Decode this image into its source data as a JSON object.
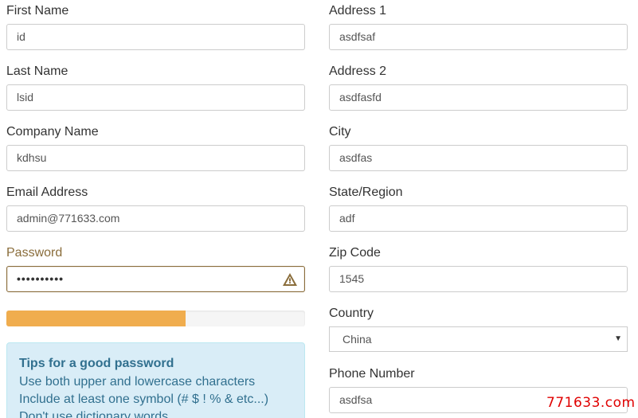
{
  "left": {
    "first_name": {
      "label": "First Name",
      "value": "id"
    },
    "last_name": {
      "label": "Last Name",
      "value": "lsid"
    },
    "company_name": {
      "label": "Company Name",
      "value": "kdhsu"
    },
    "email": {
      "label": "Email Address",
      "value": "admin@771633.com"
    },
    "password": {
      "label": "Password",
      "value": "••••••••••",
      "icon": "warning-triangle-icon"
    },
    "strength": {
      "percent": 60,
      "color": "#f0ad4e"
    },
    "tips": {
      "title": "Tips for a good password",
      "lines": [
        "Use both upper and lowercase characters",
        "Include at least one symbol (# $ ! % & etc...)",
        "Don't use dictionary words"
      ]
    }
  },
  "right": {
    "address1": {
      "label": "Address 1",
      "value": "asdfsaf"
    },
    "address2": {
      "label": "Address 2",
      "value": "asdfasfd"
    },
    "city": {
      "label": "City",
      "value": "asdfas"
    },
    "state": {
      "label": "State/Region",
      "value": "adf"
    },
    "zip": {
      "label": "Zip Code",
      "value": "1545"
    },
    "country": {
      "label": "Country",
      "value": "China"
    },
    "phone": {
      "label": "Phone Number",
      "value": "asdfsa"
    }
  },
  "watermark": "771633.com",
  "colors": {
    "warning": "#8a6d3b",
    "progress": "#f0ad4e",
    "tips_bg": "#d9edf7",
    "tips_text": "#31708f"
  }
}
